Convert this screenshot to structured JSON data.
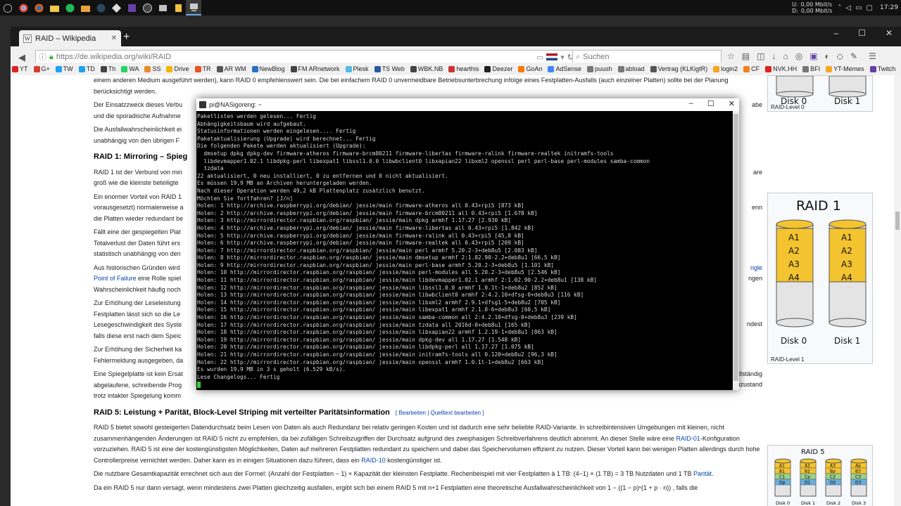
{
  "taskbar": {
    "icons": [
      "start-icon",
      "chrome-icon",
      "firefox-icon",
      "explorer-icon",
      "spotify-icon",
      "folder-icon",
      "steam-icon",
      "unity-icon",
      "twitch-icon",
      "obs-icon",
      "media-icon",
      "files-icon",
      "putty-icon"
    ],
    "net_up_label": "U:",
    "net_up": "0,00 Mbit/s",
    "net_down_label": "D:",
    "net_down": "0,00 Mbit/s",
    "clock": "17:29"
  },
  "browser": {
    "tab_title": "RAID – Wikipedia",
    "new_tab": "+",
    "url": "https://de.wikipedia.org/wiki/RAID",
    "search_placeholder": "Suchen",
    "window_controls": {
      "min": "–",
      "max": "☐",
      "close": "✕"
    }
  },
  "bookmarks": [
    {
      "label": "YT",
      "color": "#e02020"
    },
    {
      "label": "G+",
      "color": "#d23f31"
    },
    {
      "label": "TW",
      "color": "#1da1f2"
    },
    {
      "label": "TD",
      "color": "#1da1f2"
    },
    {
      "label": "Th",
      "color": "#444444"
    },
    {
      "label": "WA",
      "color": "#25d366"
    },
    {
      "label": "SS",
      "color": "#e88b2a"
    },
    {
      "label": "Drive",
      "color": "#f4b400"
    },
    {
      "label": "TR",
      "color": "#e95420"
    },
    {
      "label": "AR WM",
      "color": "#555555"
    },
    {
      "label": "NewBlog",
      "color": "#2a72c0"
    },
    {
      "label": "FM ARnetwork",
      "color": "#444444"
    },
    {
      "label": "Plesk",
      "color": "#52bbe6"
    },
    {
      "label": "TS Web",
      "color": "#2c5aa0"
    },
    {
      "label": "WBK.NB",
      "color": "#444444"
    },
    {
      "label": "hearthis",
      "color": "#cc3333"
    },
    {
      "label": "Deezer",
      "color": "#222222"
    },
    {
      "label": "GoAn",
      "color": "#f57c00"
    },
    {
      "label": "AdSense",
      "color": "#4285f4"
    },
    {
      "label": "puush",
      "color": "#777777"
    },
    {
      "label": "abload",
      "color": "#777777"
    },
    {
      "label": "Vertrag (KLKigtR)",
      "color": "#555555"
    },
    {
      "label": "login2",
      "color": "#f5a623"
    },
    {
      "label": "CF",
      "color": "#f38020"
    },
    {
      "label": "NVK.HH",
      "color": "#e02020"
    },
    {
      "label": "BFI",
      "color": "#777777"
    },
    {
      "label": "YT-Memes",
      "color": "#f5a623"
    },
    {
      "label": "Twitch",
      "color": "#6441a5"
    }
  ],
  "wiki": {
    "p1": "einem anderen Medium ausgeführt werden), kann RAID 0 empfehlenswert sein. Die bei einfachem RAID 0 unvermeidbare Betriebsunterbrechung infolge eines Festplatten-Ausfalls (auch einzelner Platten) sollte bei der Planung berücksichtigt werden.",
    "p2a": "Der Einsatzzweck dieses Verbu",
    "p2b": "abe",
    "p2c": "und die sporadische Aufnahme",
    "p3a": "Die Ausfallwahrscheinlichkeit ei",
    "p3b": "unabhängig von den übrigen F",
    "h_raid1": "RAID 1: Mirroring – Spieg",
    "r1a": "RAID 1 ist der Verbund von min",
    "r1b": "groß wie die kleinste beteiligte",
    "r1c": "Ein enormer Vorteil von RAID 1",
    "r1d": "vorausgesetzt) normalerweise a",
    "r1e": "die Platten wieder redundant be",
    "r1f": "Fällt eine der gespiegelten Plat",
    "r1g": "Totalverlust der Daten führt ers",
    "r1h": "statistisch unabhängig von den",
    "r1i": "Aus historischen Gründen wird",
    "r1j_link": "Point of Failure",
    "r1j": " eine Rolle spiel",
    "r1k": "Wahrscheinlichkeit häufig noch",
    "r1l": "Zur Erhöhung der Leseleistung",
    "r1m": "Festplatten lässt sich so die Le",
    "r1n": "Lesegeschwindigkeit des Syste",
    "r1o": "falls diese erst nach dem Speic",
    "r1p": "Zur Erhöhung der Sicherheit ka",
    "r1q": "Fehlermeldung ausgegeben, da",
    "r1r": "Eine Spiegelplatte ist kein Ersat",
    "r1s": "abgelaufene, schreibende Prog",
    "r1t": "trotz intakter Spiegelung komm",
    "right1": "ngle",
    "right2": "ngen",
    "right3": "are",
    "right4": "enn",
    "right5": "ndest",
    "right6": "gilt insbesondere für unvollständig",
    "right7": "auch zu einem inkonsistenten Datenzustand",
    "h_raid5": "RAID 5: Leistung + Parität, Block-Level Striping mit verteilter Paritätsinformation",
    "h_raid5_edit": "[ Bearbeiten | Quelltext bearbeiten ]",
    "r5a": "RAID 5 bietet sowohl gesteigerten Datendurchsatz beim Lesen von Daten als auch Redundanz bei relativ geringen Kosten und ist dadurch eine sehr beliebte RAID-Variante. In schreibintensiven Umgebungen mit kleinen, nicht zusammenhängenden Änderungen ist RAID 5 nicht zu empfehlen, da bei zufälligen Schreibzugriffen der Durchsatz aufgrund des zweiphasigen Schreibverfahrens deutlich abnimmt. An dieser Stelle wäre eine ",
    "r5a_link": "RAID-01",
    "r5a2": "-Konfiguration vorzuziehen. RAID 5 ist eine der kostengünstigsten Möglichkeiten, Daten auf mehreren Festplatten redundant zu speichern und dabei das Speichervolumen effizient zu nutzen. Dieser Vorteil kann bei wenigen Platten allerdings durch hohe Controllerpreise vernichtet werden. Daher kann es in einigen Situationen dazu führen, dass ein ",
    "r5a_link2": "RAID-10",
    "r5a3": " kostengünstiger ist.",
    "r5b": "Die nutzbare Gesamtkapazität errechnet sich aus der Formel: (Anzahl der Festplatten − 1) × Kapazität der kleinsten Festplatte. Rechenbeispiel mit vier Festplatten à 1 TB: (4−1) × (1 TB) = 3 TB Nutzdaten und 1 TB ",
    "r5b_link": "Parität",
    "r5b2": ".",
    "r5c": "Da ein RAID 5 nur dann versagt, wenn mindestens zwei Platten gleichzeitig ausfallen, ergibt sich bei einem RAID 5 mit n+1 Festplatten eine theoretische Ausfallwahrscheinlichkeit von 1 − ((1 − p)ⁿ(1 + p · n)) , falls die"
  },
  "figures": {
    "raid0": {
      "disk0": "Disk 0",
      "disk1": "Disk 1",
      "caption": "RAID-Level 0"
    },
    "raid1": {
      "title": "RAID 1",
      "blocks": [
        "A1",
        "A2",
        "A3",
        "A4"
      ],
      "disk0": "Disk 0",
      "disk1": "Disk 1",
      "caption": "RAID-Level 1"
    },
    "raid5": {
      "title": "RAID 5",
      "disks": [
        "Disk 0",
        "Disk 1",
        "Disk 2",
        "Disk 3"
      ],
      "rows": [
        [
          "A1",
          "A2",
          "A3",
          "Ap"
        ],
        [
          "B1",
          "B2",
          "Bp",
          "B3"
        ],
        [
          "C1",
          "Cp",
          "C2",
          "C3"
        ],
        [
          "Dp",
          "D1",
          "D2",
          "D3"
        ]
      ]
    }
  },
  "terminal": {
    "title": "pi@NASigoreng: ~",
    "lines": [
      "Paketlisten werden gelesen... Fertig",
      "Abhängigkeitsbaum wird aufgebaut.",
      "Statusinformationen werden eingelesen.... Fertig",
      "Paketaktualisierung (Upgrade) wird berechnet... Fertig",
      "Die folgenden Pakete werden aktualisiert (Upgrade):",
      "  dmsetup dpkg dpkg-dev firmware-atheros firmware-brcm80211 firmware-libertas firmware-ralink firmware-realtek initramfs-tools",
      "  libdevmapper1.02.1 libdpkg-perl libexpat1 libssl1.0.0 libwbclient0 libxapian22 libxml2 openssl perl perl-base perl-modules samba-common",
      "  tzdata",
      "22 aktualisiert, 0 neu installiert, 0 zu entfernen und 0 nicht aktualisiert.",
      "Es müssen 19,9 MB an Archiven heruntergeladen werden.",
      "Nach dieser Operation werden 49,2 kB Plattenplatz zusätzlich benutzt.",
      "Möchten Sie fortfahren? [J/n]",
      "Holen: 1 http://archive.raspberrypi.org/debian/ jessie/main firmware-atheros all 0.43+rpi5 [873 kB]",
      "Holen: 2 http://archive.raspberrypi.org/debian/ jessie/main firmware-brcm80211 all 0.43+rpi5 [1.678 kB]",
      "Holen: 3 http://mirrordirector.raspbian.org/raspbian/ jessie/main dpkg armhf 1.17.27 [2.930 kB]",
      "Holen: 4 http://archive.raspberrypi.org/debian/ jessie/main firmware-libertas all 0.43+rpi5 [1.842 kB]",
      "Holen: 5 http://archive.raspberrypi.org/debian/ jessie/main firmware-ralink all 0.43+rpi5 [45,8 kB]",
      "Holen: 6 http://archive.raspberrypi.org/debian/ jessie/main firmware-realtek all 0.43+rpi5 [209 kB]",
      "Holen: 7 http://mirrordirector.raspbian.org/raspbian/ jessie/main perl armhf 5.20.2-3+deb8u5 [2.083 kB]",
      "Holen: 8 http://mirrordirector.raspbian.org/raspbian/ jessie/main dmsetup armhf 2:1.02.90-2.2+deb8u1 [66,5 kB]",
      "Holen: 9 http://mirrordirector.raspbian.org/raspbian/ jessie/main perl-base armhf 5.20.2-3+deb8u5 [1.101 kB]",
      "Holen: 10 http://mirrordirector.raspbian.org/raspbian/ jessie/main perl-modules all 5.20.2-3+deb8u5 [2.546 kB]",
      "Holen: 11 http://mirrordirector.raspbian.org/raspbian/ jessie/main libdevmapper1.02.1 armhf 2:1.02.90-2.2+deb8u1 [138 kB]",
      "Holen: 12 http://mirrordirector.raspbian.org/raspbian/ jessie/main libssl1.0.0 armhf 1.0.1t-1+deb8u2 [852 kB]",
      "Holen: 13 http://mirrordirector.raspbian.org/raspbian/ jessie/main libwbclient0 armhf 2:4.2.10+dfsg-0+deb8u3 [116 kB]",
      "Holen: 14 http://mirrordirector.raspbian.org/raspbian/ jessie/main libxml2 armhf 2.9.1+dfsg1-5+deb8u2 [705 kB]",
      "Holen: 15 http://mirrordirector.raspbian.org/raspbian/ jessie/main libexpat1 armhf 2.1.0-6+deb8u3 [60,5 kB]",
      "Holen: 16 http://mirrordirector.raspbian.org/raspbian/ jessie/main samba-common all 2:4.2.10+dfsg-0+deb8u3 [239 kB]",
      "Holen: 17 http://mirrordirector.raspbian.org/raspbian/ jessie/main tzdata all 2016d-0+deb8u1 [165 kB]",
      "Holen: 18 http://mirrordirector.raspbian.org/raspbian/ jessie/main libxapian22 armhf 1.2.19-1+deb8u1 [863 kB]",
      "Holen: 19 http://mirrordirector.raspbian.org/raspbian/ jessie/main dpkg-dev all 1.17.27 [1.548 kB]",
      "Holen: 20 http://mirrordirector.raspbian.org/raspbian/ jessie/main libdpkg-perl all 1.17.27 [1.075 kB]",
      "Holen: 21 http://mirrordirector.raspbian.org/raspbian/ jessie/main initramfs-tools all 0.120+deb8u2 [96,3 kB]",
      "Holen: 22 http://mirrordirector.raspbian.org/raspbian/ jessie/main openssl armhf 1.0.1t-1+deb8u2 [663 kB]",
      "Es wurden 19,9 MB in 3 s geholt (6.529 kB/s).",
      "Lese Changelogs... Fertig"
    ]
  }
}
